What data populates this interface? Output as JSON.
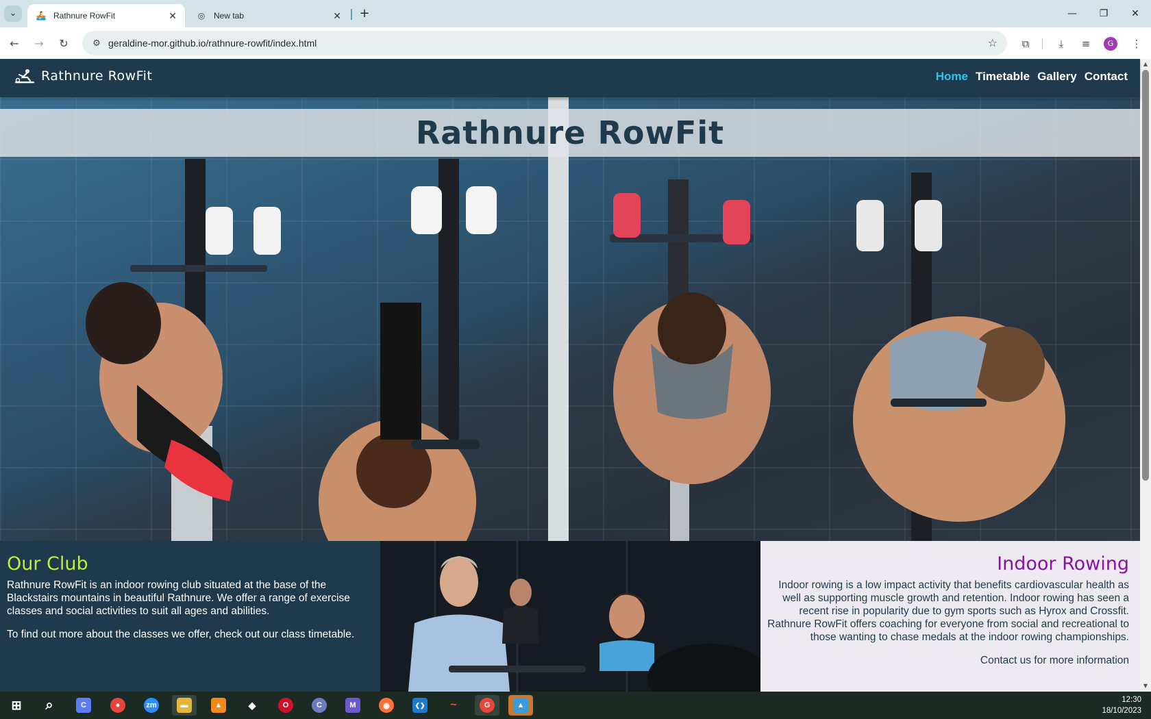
{
  "browser": {
    "tabs": [
      {
        "title": "Rathnure RowFit",
        "active": true
      },
      {
        "title": "New tab",
        "active": false
      }
    ],
    "url": "geraldine-mor.github.io/rathnure-rowfit/index.html",
    "profile_initial": "G"
  },
  "site": {
    "brand": "Rathnure RowFit",
    "nav": [
      {
        "label": "Home",
        "current": true
      },
      {
        "label": "Timetable",
        "current": false
      },
      {
        "label": "Gallery",
        "current": false
      },
      {
        "label": "Contact",
        "current": false
      }
    ],
    "hero_title": "Rathnure RowFit",
    "our_club": {
      "heading": "Our Club",
      "paragraphs": [
        "Rathnure RowFit is an indoor rowing club situated at the base of the Blackstairs mountains in beautiful Rathnure. We offer a range of exercise classes and social activities to suit all ages and abilities.",
        "To find out more about the classes we offer, check out our class timetable."
      ]
    },
    "indoor_rowing": {
      "heading": "Indoor Rowing",
      "paragraphs": [
        "Indoor rowing is a low impact activity that benefits cardiovascular health as well as supporting muscle growth and retention. Indoor rowing has seen a recent rise in popularity due to gym sports such as Hyrox and Crossfit. Rathnure RowFit offers coaching for everyone from social and recreational to those wanting to chase medals at the indoor rowing championships.",
        "Contact us for more information"
      ]
    }
  },
  "taskbar": {
    "apps": [
      {
        "name": "start",
        "label": "⊞",
        "color": "#1b2b24"
      },
      {
        "name": "search",
        "label": "⌕",
        "color": "#1b2b24"
      },
      {
        "name": "copilot",
        "label": "C",
        "color": "#5b7cf5"
      },
      {
        "name": "chrome",
        "label": "●",
        "color": "#e8453c"
      },
      {
        "name": "zoom",
        "label": "zm",
        "color": "#2d8cff"
      },
      {
        "name": "file-explorer",
        "label": "▬",
        "color": "#e8b53a"
      },
      {
        "name": "vlc",
        "label": "▲",
        "color": "#f08a1c"
      },
      {
        "name": "security",
        "label": "◆",
        "color": "#1b2b24"
      },
      {
        "name": "opera",
        "label": "O",
        "color": "#d1102b"
      },
      {
        "name": "app-c",
        "label": "C",
        "color": "#6d7cbf"
      },
      {
        "name": "m365",
        "label": "M",
        "color": "#6a5acd"
      },
      {
        "name": "firefox",
        "label": "◉",
        "color": "#ff7139"
      },
      {
        "name": "vscode",
        "label": "❮❯",
        "color": "#1e7acf"
      },
      {
        "name": "git-app",
        "label": "~",
        "color": "#1b2b24"
      },
      {
        "name": "chrome-profile",
        "label": "G",
        "color": "#e8453c"
      },
      {
        "name": "photos",
        "label": "▲",
        "color": "#3a9bd8"
      }
    ],
    "time": "12:30",
    "date": "18/10/2023"
  }
}
